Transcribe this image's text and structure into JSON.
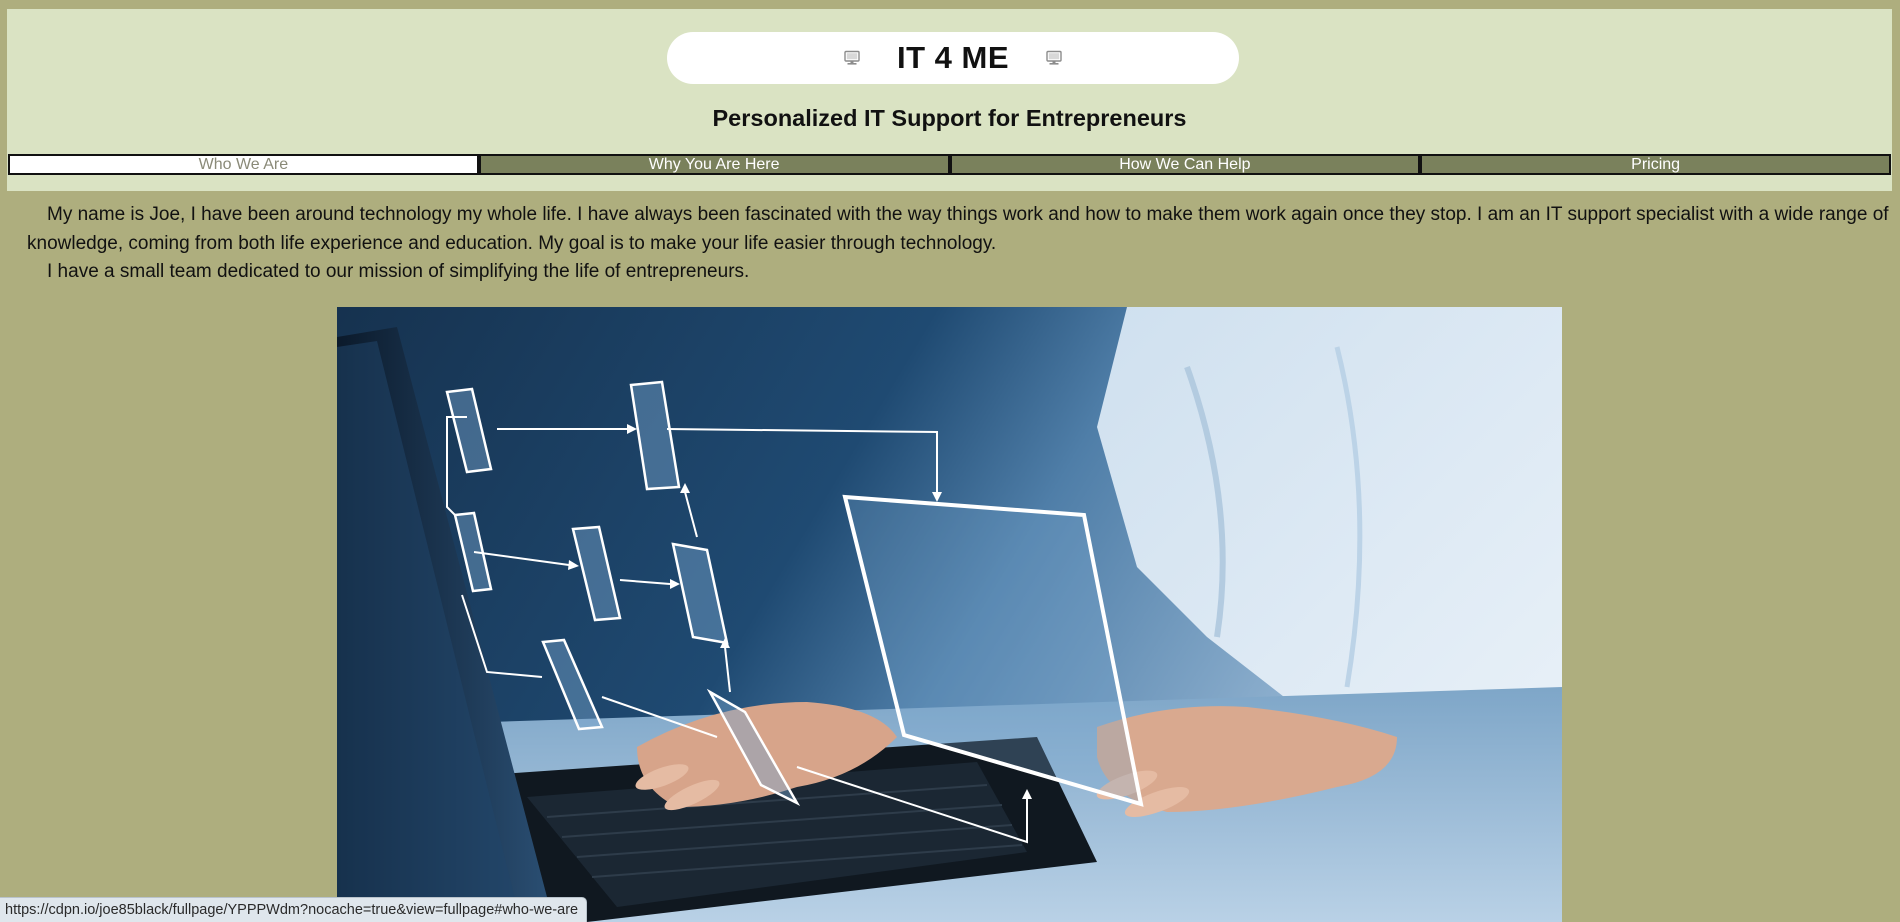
{
  "site": {
    "title": "IT 4 ME",
    "logo_icon_left": "computer-icon",
    "logo_icon_right": "computer-icon",
    "tagline": "Personalized IT Support for Entrepreneurs"
  },
  "nav": {
    "tabs": [
      {
        "label": "Who We Are",
        "active": true
      },
      {
        "label": "Why You Are Here",
        "active": false
      },
      {
        "label": "How We Can Help",
        "active": false
      },
      {
        "label": "Pricing",
        "active": false
      }
    ]
  },
  "intro": {
    "paragraph_1": "My name is Joe, I have been around technology my whole life. I have always been fascinated with the way things work and how to make them work again once they stop. I am an IT support specialist with a wide range of knowledge, coming from both life experience and education. My goal is to make your life easier through technology.",
    "paragraph_2": "I have a small team dedicated to our mission of simplifying the life of entrepreneurs."
  },
  "hero": {
    "subject": "hands-typing-laptop-with-flowchart-overlay"
  },
  "status_bar": {
    "url": "https://cdpn.io/joe85black/fullpage/YPPPWdm?nocache=true&view=fullpage#who-we-are"
  },
  "colors": {
    "page_background": "#aeae7e",
    "header_background": "#dae3c3",
    "nav_tab": "#7a815c",
    "nav_tab_active": "#ffffff"
  }
}
